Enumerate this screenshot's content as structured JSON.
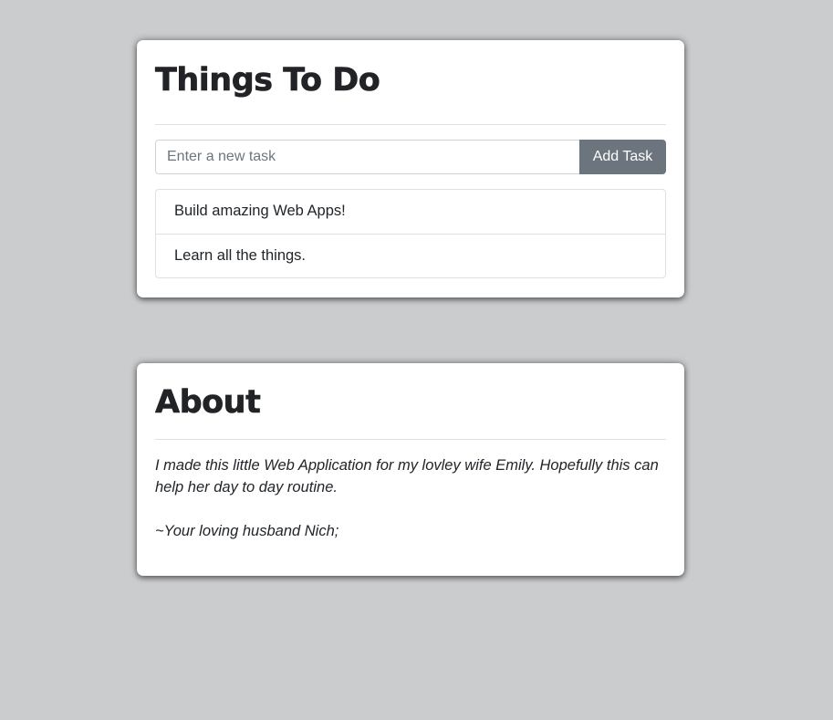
{
  "todo": {
    "title": "Things To Do",
    "input_placeholder": "Enter a new task",
    "input_value": "",
    "add_button_label": "Add Task",
    "tasks": [
      {
        "label": "Build amazing Web Apps!"
      },
      {
        "label": "Learn all the things."
      }
    ]
  },
  "about": {
    "title": "About",
    "message": "I made this little Web Application for my lovley wife Emily. Hopefully this can help her day to day routine.",
    "signature": "~Your loving husband Nich;"
  },
  "colors": {
    "background": "#cbccce",
    "card": "#ffffff",
    "button": "#6c757d",
    "text": "#212529"
  }
}
